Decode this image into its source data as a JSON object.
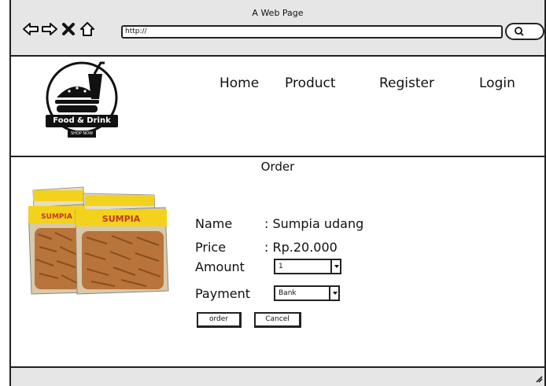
{
  "window": {
    "title": "A Web Page"
  },
  "browser": {
    "url": "http://",
    "icons": [
      "back-arrow-icon",
      "forward-arrow-icon",
      "close-icon",
      "home-icon",
      "search-icon"
    ]
  },
  "logo": {
    "name": "Food & Drink",
    "tagline": "SHOP NOW"
  },
  "nav": {
    "home": "Home",
    "product": "Product",
    "register": "Register",
    "login": "Login"
  },
  "order": {
    "title": "Order",
    "name_label": "Name",
    "name_value": ": Sumpia udang",
    "price_label": "Price",
    "price_value": ": Rp.20.000",
    "amount_label": "Amount",
    "amount_value": "1",
    "payment_label": "Payment",
    "payment_value": "Bank",
    "order_button": "order",
    "cancel_button": "Cancel"
  },
  "product_image": {
    "brand": "SUMPIA"
  },
  "colors": {
    "chrome": "#e6e6e6",
    "border": "#222222",
    "package_label": "#f2d21c",
    "snack": "#b8743a"
  }
}
